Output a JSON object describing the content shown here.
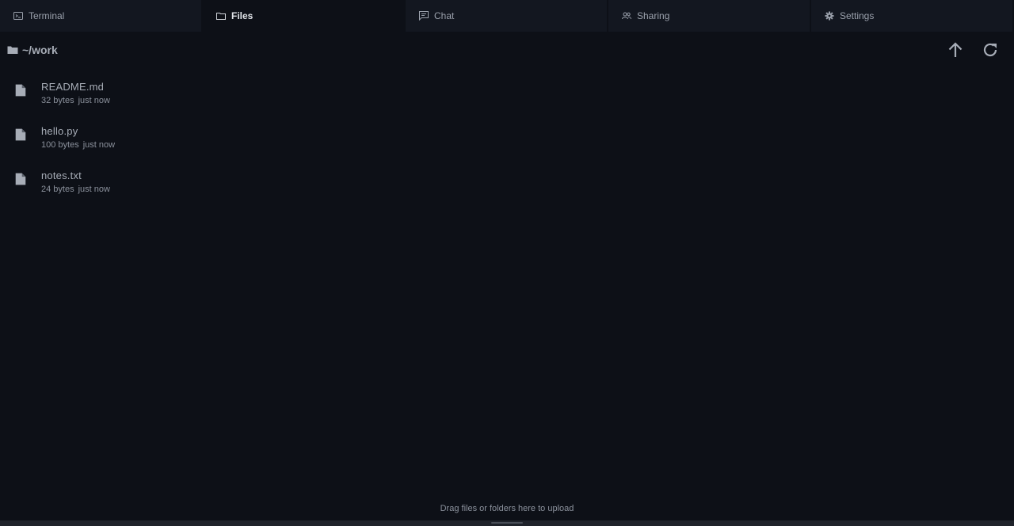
{
  "tabs": [
    {
      "label": "Terminal",
      "icon": "terminal-icon",
      "active": false
    },
    {
      "label": "Files",
      "icon": "folder-icon",
      "active": true
    },
    {
      "label": "Chat",
      "icon": "chat-icon",
      "active": false
    },
    {
      "label": "Sharing",
      "icon": "users-icon",
      "active": false
    },
    {
      "label": "Settings",
      "icon": "gear-icon",
      "active": false
    }
  ],
  "path": {
    "label": "~/work",
    "icon": "folder-icon"
  },
  "actions": {
    "up_icon": "arrow-up-icon",
    "refresh_icon": "refresh-icon"
  },
  "files": [
    {
      "name": "README.md",
      "size": "32 bytes",
      "modified": "just now",
      "icon": "file-icon"
    },
    {
      "name": "hello.py",
      "size": "100 bytes",
      "modified": "just now",
      "icon": "file-icon"
    },
    {
      "name": "notes.txt",
      "size": "24 bytes",
      "modified": "just now",
      "icon": "file-icon"
    }
  ],
  "dropzone": {
    "text": "Drag files or folders here to upload"
  }
}
